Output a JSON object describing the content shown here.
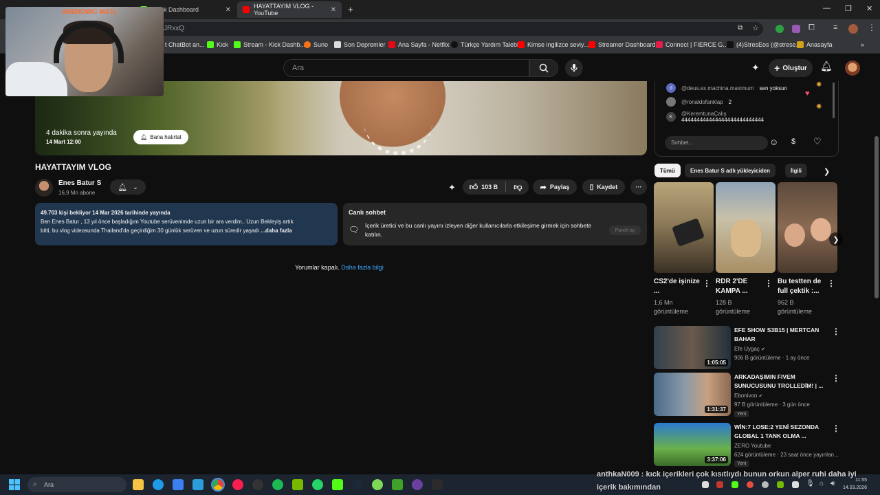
{
  "browser": {
    "tabs": [
      {
        "label": "- Kick Dashboard",
        "active": false
      },
      {
        "label": "HAYATTAYIM VLOG - YouTube",
        "active": true
      }
    ],
    "url_fragment": "JRxxQ",
    "bookmarks": [
      "t ChatBot an...",
      "Kick",
      "Stream - Kick Dashb...",
      "Suno",
      "Son Depremler",
      "Ana Sayfa - Netflix",
      "Türkçe Yardım Talebi",
      "Kimse ingilizce seviy...",
      "Streamer Dashboard",
      "Connect | FIERCE G...",
      "(4)StresEos (@strese...",
      "Anasayfa"
    ],
    "more_bookmarks": "»"
  },
  "overlay": {
    "webcam_label": "OMEROWIC 401TL",
    "marquee_line1": "anthkaN009 : kıck içerikleri çok kısıtlıydı bunun orkun alper ruhi daha iyi",
    "marquee_line2": "içerik bakımından"
  },
  "youtube": {
    "search_placeholder": "Ara",
    "create_label": "Oluştur",
    "player": {
      "premiere_text": "4 dakika sonra yayında",
      "premiere_date": "14 Mart 12:00",
      "remind_label": "Bana hatırlat"
    },
    "video": {
      "title": "HAYATTAYIM VLOG",
      "channel_name": "Enes Batur S",
      "subscribers": "16,9 Mn abone",
      "likes": "103 B",
      "share_label": "Paylaş",
      "save_label": "Kaydet"
    },
    "description": {
      "meta": "49.703 kişi bekliyor  14 Mar 2026 tarihinde yayında",
      "line1": "Ben Enes Batur , 13 yıl önce başladığım Youtube serüvenimde uzun bir ara verdim.. Uzun Bekleyiş artık",
      "line2": "bitti, bu vlog videosunda Thailand'da geçirdiğim 30 günlük serüven ve uzun süredir yaşadı",
      "more": "...daha fazla"
    },
    "live_chat_card": {
      "title": "Canlı sohbet",
      "text": "İçerik üretici ve bu canlı yayını izleyen diğer kullanıcılarla etkileşime girmek için sohbete katılın.",
      "button": "Paneli aç"
    },
    "comments_off": "Yorumlar kapalı.",
    "comments_more": "Daha fazla bilgi",
    "chat": {
      "messages": [
        {
          "avatar": "d",
          "user": "@deus.ex.machina.maximum",
          "text": "sen yoksun"
        },
        {
          "avatar": "",
          "user": "@ronaldofanklap",
          "text": "2"
        },
        {
          "avatar": "K",
          "user": "@KeremtunaÇalış",
          "text": "444444444444444444444444444"
        }
      ],
      "input_placeholder": "Sohbet..."
    },
    "filters": [
      "Tümü",
      "Enes Batur S adlı yükleyiciden",
      "İlgili"
    ],
    "shorts": [
      {
        "title": "CS2'de işinize ...",
        "views": "1,6 Mn görüntüleme"
      },
      {
        "title": "RDR 2'DE KAMPA ...",
        "views": "128 B görüntüleme"
      },
      {
        "title": "Bu testten de full çektik :...",
        "views": "962 B görüntüleme"
      }
    ],
    "videos": [
      {
        "title": "EFE SHOW S3B15 | MERTCAN BAHAR",
        "channel": "Efe Uygaç",
        "meta": "906 B görüntüleme · 1 ay önce",
        "duration": "1:05:05",
        "badge": ""
      },
      {
        "title": "ARKADAŞIMIN FIVEM SUNUCUSUNU TROLLEDİM! | ...",
        "channel": "Ebonivon",
        "meta": "97 B görüntüleme · 3 gün önce",
        "duration": "1:31:37",
        "badge": "Yeni"
      },
      {
        "title": "WİN:7 LOSE:2 YENİ SEZONDA GLOBAL 1 TANK OLMA ...",
        "channel": "ZERO Youtube",
        "meta": "624 görüntüleme · 23 saat önce yayınlan...",
        "duration": "3:37:06",
        "badge": "Yeni"
      }
    ]
  },
  "taskbar": {
    "search_placeholder": "Ara",
    "time": "11:55",
    "date": "14.03.2026"
  },
  "colors": {
    "background": "#0f0f0f",
    "description_bg": "#21364f",
    "link": "#3ea6ff"
  }
}
